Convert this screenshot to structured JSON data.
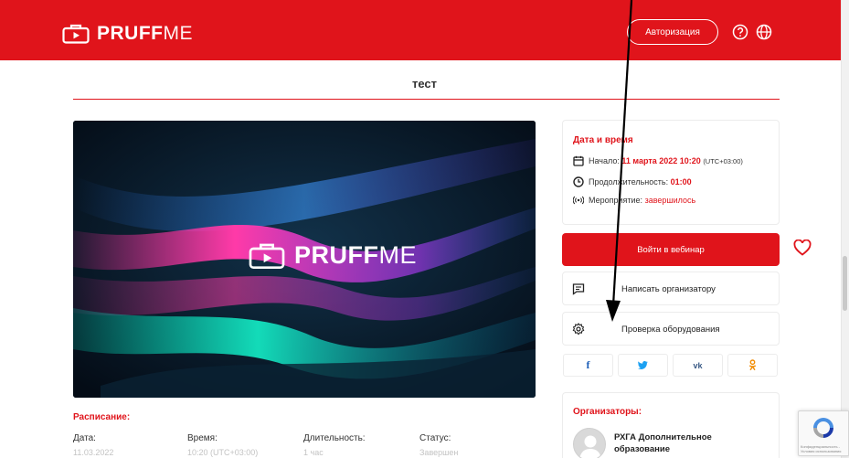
{
  "header": {
    "brand_bold": "PRUFF",
    "brand_light": "ME",
    "auth_label": "Авторизация"
  },
  "event": {
    "title": "тест"
  },
  "video": {
    "brand_bold": "PRUFF",
    "brand_light": "ME"
  },
  "datetime": {
    "title": "Дата и время",
    "start_label": "Начало:",
    "start_value": "11 марта 2022 10:20",
    "start_tz": "(UTC+03:00)",
    "duration_label": "Продолжительность:",
    "duration_value": "01:00",
    "status_label": "Мероприятие:",
    "status_value": "завершилось"
  },
  "actions": {
    "join_label": "Войти в вебинар",
    "write_label": "Написать организатору",
    "check_label": "Проверка оборудования"
  },
  "social": {
    "facebook": "f",
    "vk": "vk"
  },
  "organizers": {
    "title": "Организаторы:",
    "name": "РХГА Дополнительное образование"
  },
  "schedule": {
    "title": "Расписание:",
    "headers": [
      "Дата:",
      "Время:",
      "Длительность:",
      "Статус:"
    ],
    "values": [
      "11.03.2022",
      "10:20 (UTC+03:00)",
      "1 час",
      "Завершен"
    ]
  },
  "recaptcha": {
    "text": "Конфиденциальность - Условия использования"
  },
  "colors": {
    "brand_red": "#e0141b",
    "muted_text": "#c3c3c3"
  }
}
